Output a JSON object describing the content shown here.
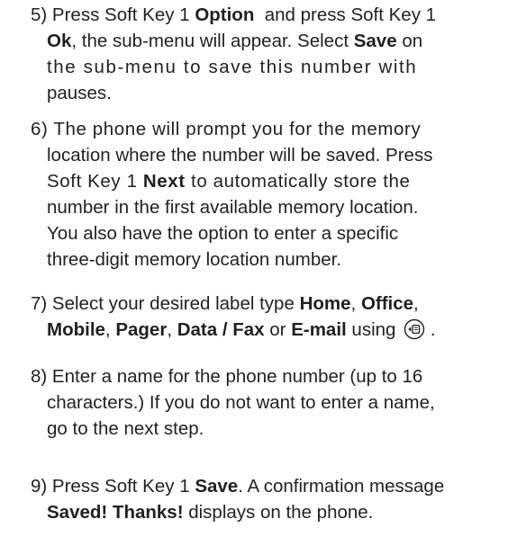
{
  "steps": [
    {
      "lines": [
        [
          "5) Press Soft Key 1 ",
          {
            "b": "Option"
          },
          "  and press Soft Key 1"
        ],
        [
          {
            "b": "Ok"
          },
          ", the sub-menu will appear. Select ",
          {
            "b": "Save"
          },
          " on"
        ],
        [
          "the sub-menu to save this number with"
        ],
        [
          "pauses."
        ]
      ]
    },
    {
      "lines": [
        [
          "6) The phone will prompt you for the memory"
        ],
        [
          "location where the number will be saved. Press"
        ],
        [
          "Soft Key 1 ",
          {
            "b": "Next"
          },
          " to automatically store the"
        ],
        [
          "number in the first available memory location."
        ],
        [
          "You also have the option to enter a specific"
        ],
        [
          "three-digit memory location number."
        ]
      ]
    },
    {
      "lines": [
        [
          "7) Select your desired label type ",
          {
            "b": "Home"
          },
          ", ",
          {
            "b": "Office"
          },
          ","
        ],
        [
          {
            "b": "Mobile"
          },
          ", ",
          {
            "b": "Pager"
          },
          ", ",
          {
            "b": "Data / Fax"
          },
          " or ",
          {
            "b": "E-mail"
          },
          " using ",
          {
            "icon": "navigation-key-icon"
          },
          " ."
        ]
      ]
    },
    {
      "lines": [
        [
          "8) Enter a name for the phone number (up to 16"
        ],
        [
          "characters.) If you do not want to enter a name,"
        ],
        [
          "go to the next step."
        ]
      ]
    },
    {
      "lines": [
        [
          "9) Press Soft Key 1 ",
          {
            "b": "Save"
          },
          ". A confirmation message"
        ],
        [
          {
            "b": "Saved! Thanks!"
          },
          " displays on the phone."
        ]
      ]
    }
  ]
}
